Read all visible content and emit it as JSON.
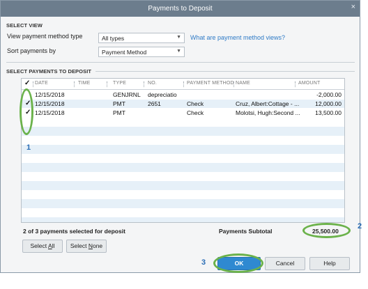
{
  "window": {
    "title": "Payments to Deposit",
    "close_glyph": "×"
  },
  "select_view": {
    "heading": "SELECT VIEW",
    "method_type_label": "View payment method type",
    "method_type_value": "All types",
    "sort_label": "Sort payments by",
    "sort_value": "Payment Method",
    "help_link": "What are payment method views?"
  },
  "payments": {
    "heading": "SELECT PAYMENTS TO DEPOSIT",
    "columns": {
      "check": "✓",
      "date": "DATE",
      "time": "TIME",
      "type": "TYPE",
      "no": "NO.",
      "method": "PAYMENT METHOD",
      "name": "NAME",
      "amount": "AMOUNT"
    },
    "rows": [
      {
        "checked": "",
        "date": "12/15/2018",
        "time": "",
        "type": "GENJRNL",
        "no": "depreciatio",
        "method": "",
        "name": "",
        "amount": "-2,000.00"
      },
      {
        "checked": "✓",
        "date": "12/15/2018",
        "time": "",
        "type": "PMT",
        "no": "2651",
        "method": "Check",
        "name": "Cruz, Albert:Cottage - ...",
        "amount": "12,000.00"
      },
      {
        "checked": "✓",
        "date": "12/15/2018",
        "time": "",
        "type": "PMT",
        "no": "",
        "method": "Check",
        "name": "Molotsi, Hugh:Second ...",
        "amount": "13,500.00"
      }
    ],
    "selected_summary": "2 of 3 payments selected for deposit",
    "subtotal_label": "Payments Subtotal",
    "subtotal_value": "25,500.00"
  },
  "buttons": {
    "select_all_pre": "Select ",
    "select_all_u": "A",
    "select_all_post": "ll",
    "select_none_pre": "Select ",
    "select_none_u": "N",
    "select_none_post": "one",
    "ok": "OK",
    "cancel": "Cancel",
    "help": "Help"
  },
  "callouts": {
    "one": "1",
    "two": "2",
    "three": "3"
  },
  "colors": {
    "accent": "#2f89d1",
    "highlight": "#6bb24b",
    "callout_text": "#2a6db5",
    "row_alt": "#e6f0f8"
  }
}
